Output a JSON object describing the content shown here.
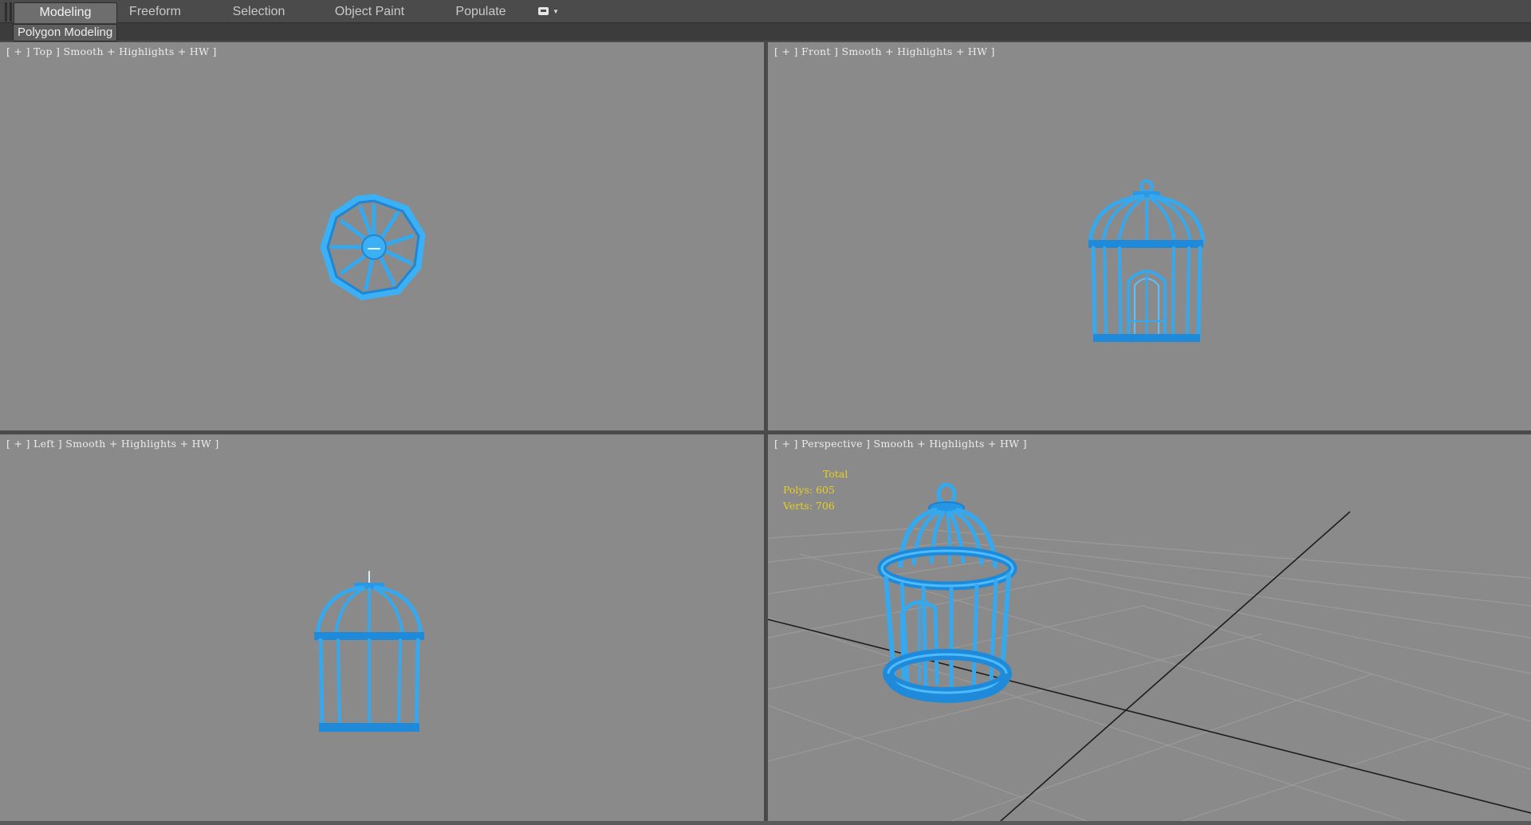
{
  "ribbon": {
    "tabs": [
      {
        "label": "Modeling",
        "active": true
      },
      {
        "label": "Freeform",
        "active": false
      },
      {
        "label": "Selection",
        "active": false
      },
      {
        "label": "Object Paint",
        "active": false
      },
      {
        "label": "Populate",
        "active": false
      }
    ],
    "toggle_icon": "ribbon-minimize-icon",
    "panel_label": "Polygon Modeling"
  },
  "viewports": {
    "top": {
      "plus": "+",
      "view": "Top",
      "shading": "Smooth + Highlights + HW"
    },
    "front": {
      "plus": "+",
      "view": "Front",
      "shading": "Smooth + Highlights + HW"
    },
    "left": {
      "plus": "+",
      "view": "Left",
      "shading": "Smooth + Highlights + HW"
    },
    "perspective": {
      "plus": "+",
      "view": "Perspective",
      "shading": "Smooth + Highlights + HW"
    }
  },
  "stats": {
    "total_label": "Total",
    "polys": "Polys: 605",
    "verts": "Verts: 706"
  },
  "colors": {
    "viewport_bg": "#8a8a8a",
    "model": "#35a8ee",
    "model_dark": "#1a7fd0",
    "stats_text": "#e8d021"
  }
}
